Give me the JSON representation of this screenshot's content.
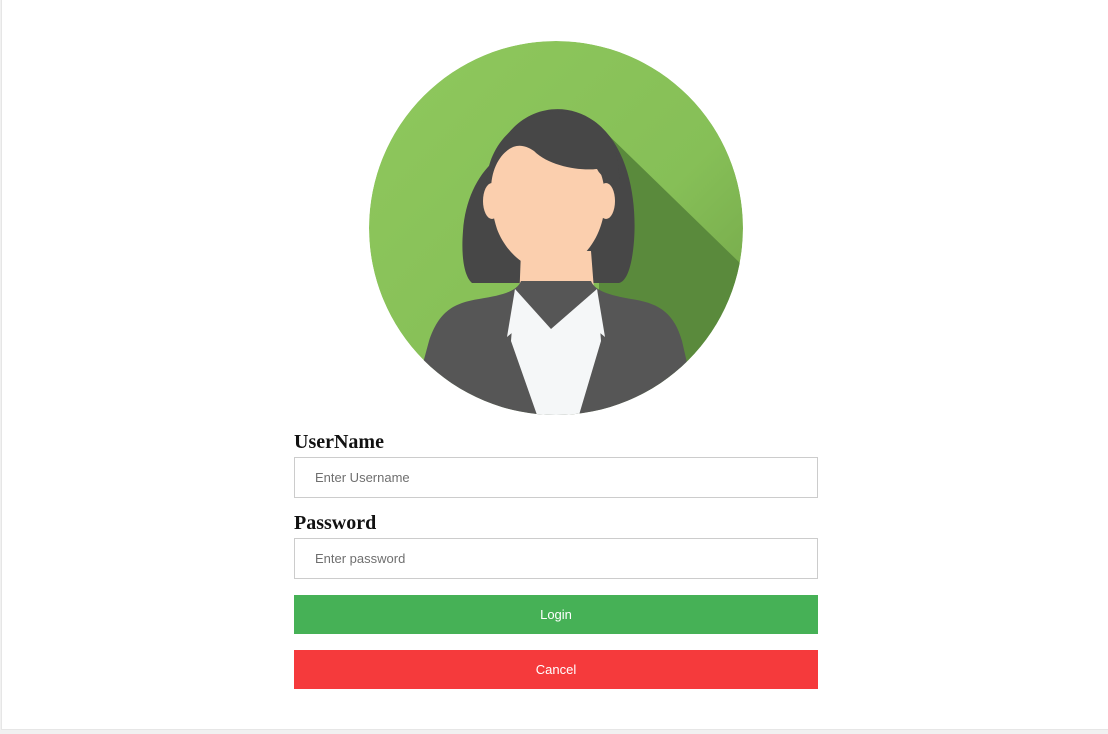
{
  "avatar": {
    "icon": "female-user-avatar-icon"
  },
  "form": {
    "username_label": "UserName",
    "username_placeholder": "Enter Username",
    "password_label": "Password",
    "password_placeholder": "Enter password",
    "login_label": "Login",
    "cancel_label": "Cancel"
  },
  "colors": {
    "avatar_bg": "#8bc45a",
    "login_button": "#46b156",
    "cancel_button": "#f53a3c"
  }
}
